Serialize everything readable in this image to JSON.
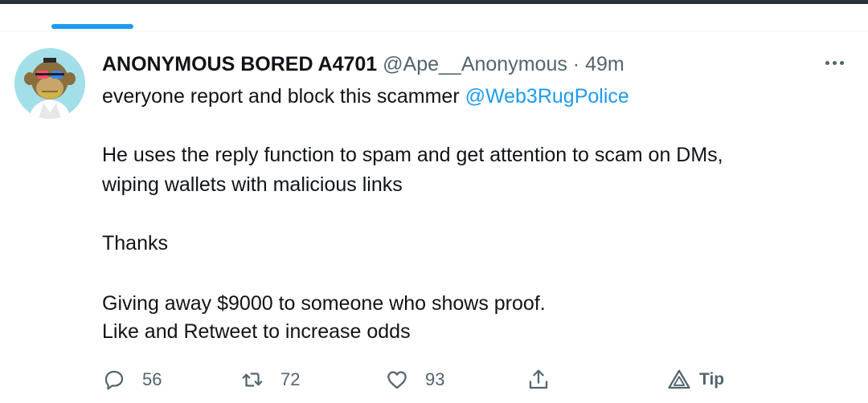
{
  "tweet": {
    "author": {
      "display_name": "ANONYMOUS BORED A4701",
      "handle": "@Ape__Anonymous",
      "avatar_icon": "bored-ape-avatar"
    },
    "separator": "·",
    "time_ago": "49m",
    "body": {
      "line1_text": "everyone report and block this scammer ",
      "line1_mention": "@Web3RugPolice",
      "line2": "He uses the reply function to spam and get attention to scam on DMs,",
      "line3": "wiping wallets with malicious links",
      "line4": "Thanks",
      "line5": "Giving away $9000 to someone who shows proof.",
      "line6": "Like and Retweet to increase odds"
    },
    "actions": {
      "replies": "56",
      "retweets": "72",
      "likes": "93",
      "tip_label": "Tip"
    }
  },
  "colors": {
    "accent": "#1d9bf0",
    "text_primary": "#0f1419",
    "text_secondary": "#536471",
    "top_bar": "#263238",
    "avatar_bg": "#a3dfe8"
  }
}
